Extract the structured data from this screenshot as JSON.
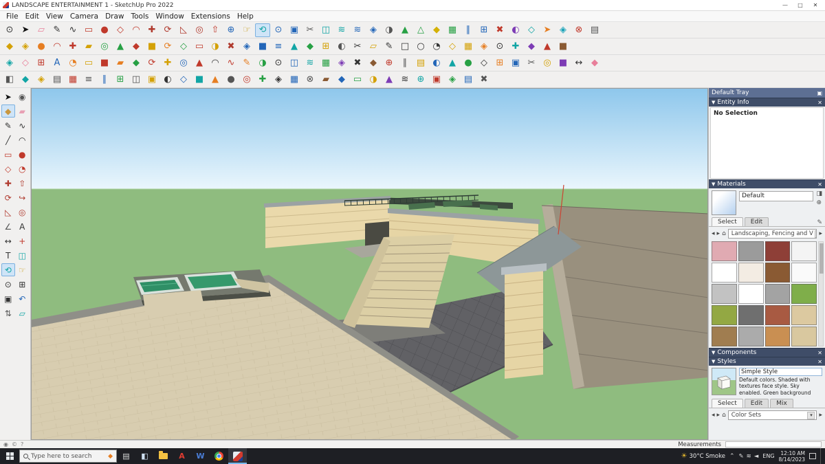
{
  "window": {
    "title": "LANDSCAPE ENTERTAINMENT 1 - SketchUp Pro 2022",
    "controls": {
      "minimize": "—",
      "maximize": "□",
      "close": "✕"
    }
  },
  "menus": [
    "File",
    "Edit",
    "View",
    "Camera",
    "Draw",
    "Tools",
    "Window",
    "Extensions",
    "Help"
  ],
  "tb1": [
    {
      "g": "⊙",
      "c": "#333333",
      "n": "zoom-icon"
    },
    {
      "g": "➤",
      "c": "#111111",
      "n": "select-tool-icon"
    },
    {
      "g": "▱",
      "c": "#e87f9a",
      "n": "eraser-icon"
    },
    {
      "g": "✎",
      "c": "#333333",
      "n": "line-tool-icon"
    },
    {
      "g": "∿",
      "c": "#333333",
      "n": "freehand-icon"
    },
    {
      "g": "▭",
      "c": "#c0392b",
      "n": "rectangle-icon"
    },
    {
      "g": "●",
      "c": "#c0392b",
      "n": "circle-icon"
    },
    {
      "g": "◇",
      "c": "#c0392b",
      "n": "polygon-icon"
    },
    {
      "g": "◠",
      "c": "#c0392b",
      "n": "arc-icon"
    },
    {
      "g": "✚",
      "c": "#b03a2e",
      "n": "move-icon"
    },
    {
      "g": "⟳",
      "c": "#b03a2e",
      "n": "rotate-icon"
    },
    {
      "g": "◺",
      "c": "#b03a2e",
      "n": "scale-icon"
    },
    {
      "g": "◎",
      "c": "#b03a2e",
      "n": "offset-icon"
    },
    {
      "g": "⇧",
      "c": "#c0392b",
      "n": "push-pull-icon"
    },
    {
      "g": "⊕",
      "c": "#2366b8"
    },
    {
      "g": "☞",
      "c": "#c9a227",
      "n": "pan-icon"
    },
    {
      "g": "⟲",
      "c": "#12a5a5",
      "n": "orbit-icon",
      "a": true
    },
    {
      "g": "⊙",
      "c": "#2366b8",
      "n": "zoom-tool-icon"
    },
    {
      "g": "▣",
      "c": "#2366b8",
      "n": "zoom-extents-icon"
    },
    {
      "g": "✂",
      "c": "#555555",
      "n": "section-icon"
    },
    {
      "g": "◫",
      "c": "#12a5a5"
    },
    {
      "g": "≋",
      "c": "#12a5a5"
    },
    {
      "g": "≋",
      "c": "#2366b8"
    },
    {
      "g": "◈",
      "c": "#2366b8"
    },
    {
      "g": "◑",
      "c": "#555555"
    },
    {
      "g": "▲",
      "c": "#27a044"
    },
    {
      "g": "△",
      "c": "#27a044"
    },
    {
      "g": "◆",
      "c": "#d4b106"
    },
    {
      "g": "▦",
      "c": "#27a044"
    },
    {
      "g": "∥",
      "c": "#2366b8"
    },
    {
      "g": "⊞",
      "c": "#2366b8"
    },
    {
      "g": "✖",
      "c": "#c0392b"
    },
    {
      "g": "◐",
      "c": "#7d3cb5"
    },
    {
      "g": "◇",
      "c": "#12a5a5"
    },
    {
      "g": "➤",
      "c": "#e67e22"
    },
    {
      "g": "◈",
      "c": "#17a2b8"
    },
    {
      "g": "⊗",
      "c": "#c0392b"
    },
    {
      "g": "▤",
      "c": "#555555"
    }
  ],
  "tb2": [
    {
      "g": "◆",
      "c": "#d4a106"
    },
    {
      "g": "◈",
      "c": "#d4a106"
    },
    {
      "g": "●",
      "c": "#e67e22"
    },
    {
      "g": "◠",
      "c": "#c0392b"
    },
    {
      "g": "✚",
      "c": "#c0392b"
    },
    {
      "g": "▰",
      "c": "#d4a106"
    },
    {
      "g": "◎",
      "c": "#27a044"
    },
    {
      "g": "▲",
      "c": "#27a044"
    },
    {
      "g": "◆",
      "c": "#c0392b"
    },
    {
      "g": "■",
      "c": "#d4a106"
    },
    {
      "g": "⟳",
      "c": "#e67e22"
    },
    {
      "g": "◇",
      "c": "#27a044"
    },
    {
      "g": "▭",
      "c": "#c0392b"
    },
    {
      "g": "◑",
      "c": "#d4a106"
    },
    {
      "g": "✖",
      "c": "#b03a2e"
    },
    {
      "g": "◈",
      "c": "#2366b8"
    },
    {
      "g": "■",
      "c": "#2366b8"
    },
    {
      "g": "≡",
      "c": "#2366b8"
    },
    {
      "g": "▲",
      "c": "#12a5a5"
    },
    {
      "g": "◆",
      "c": "#27a044"
    },
    {
      "g": "⊞",
      "c": "#d4a106"
    },
    {
      "g": "◐",
      "c": "#555555"
    },
    {
      "g": "✂",
      "c": "#333333"
    },
    {
      "g": "▱",
      "c": "#d4a106"
    },
    {
      "g": "✎",
      "c": "#333333"
    },
    {
      "g": "□",
      "c": "#333333"
    },
    {
      "g": "○",
      "c": "#333333"
    },
    {
      "g": "◔",
      "c": "#333333"
    },
    {
      "g": "◇",
      "c": "#d4a106"
    },
    {
      "g": "▦",
      "c": "#d4a106"
    },
    {
      "g": "◈",
      "c": "#e67e22"
    },
    {
      "g": "⊙",
      "c": "#333333"
    },
    {
      "g": "✚",
      "c": "#12a5a5"
    },
    {
      "g": "◆",
      "c": "#7d3cb5"
    },
    {
      "g": "▲",
      "c": "#c0392b"
    },
    {
      "g": "■",
      "c": "#8a5a33"
    }
  ],
  "tb3": [
    {
      "g": "◈",
      "c": "#12a5a5"
    },
    {
      "g": "◇",
      "c": "#e87f9a"
    },
    {
      "g": "⊞",
      "c": "#c0392b"
    },
    {
      "g": "A",
      "c": "#2366b8",
      "n": "text-style-icon"
    },
    {
      "g": "◔",
      "c": "#e67e22"
    },
    {
      "g": "▭",
      "c": "#d4a106"
    },
    {
      "g": "■",
      "c": "#c0392b"
    },
    {
      "g": "▰",
      "c": "#e67e22"
    },
    {
      "g": "◆",
      "c": "#27a044"
    },
    {
      "g": "⟳",
      "c": "#c0392b"
    },
    {
      "g": "✚",
      "c": "#d4a106"
    },
    {
      "g": "◎",
      "c": "#2366b8"
    },
    {
      "g": "▲",
      "c": "#c0392b"
    },
    {
      "g": "◠",
      "c": "#333333"
    },
    {
      "g": "∿",
      "c": "#c0392b"
    },
    {
      "g": "✎",
      "c": "#e67e22"
    },
    {
      "g": "◑",
      "c": "#27a044"
    },
    {
      "g": "⊙",
      "c": "#333333"
    },
    {
      "g": "◫",
      "c": "#2366b8"
    },
    {
      "g": "≋",
      "c": "#12a5a5"
    },
    {
      "g": "▦",
      "c": "#27a044"
    },
    {
      "g": "◈",
      "c": "#7d3cb5"
    },
    {
      "g": "✖",
      "c": "#333333"
    },
    {
      "g": "◆",
      "c": "#8a5a33"
    },
    {
      "g": "⊕",
      "c": "#c0392b"
    },
    {
      "g": "∥",
      "c": "#555555"
    },
    {
      "g": "▤",
      "c": "#d4a106"
    },
    {
      "g": "◐",
      "c": "#2366b8"
    },
    {
      "g": "▲",
      "c": "#12a5a5"
    },
    {
      "g": "●",
      "c": "#27a044"
    },
    {
      "g": "◇",
      "c": "#333333"
    },
    {
      "g": "⊞",
      "c": "#e67e22"
    },
    {
      "g": "▣",
      "c": "#2366b8"
    },
    {
      "g": "✂",
      "c": "#555555"
    },
    {
      "g": "◎",
      "c": "#d4a106"
    },
    {
      "g": "■",
      "c": "#7d3cb5"
    },
    {
      "g": "↔",
      "c": "#333333"
    },
    {
      "g": "◆",
      "c": "#e87f9a"
    }
  ],
  "tb4": [
    {
      "g": "◧",
      "c": "#555555"
    },
    {
      "g": "◆",
      "c": "#12a5a5"
    },
    {
      "g": "◈",
      "c": "#d4a106"
    },
    {
      "g": "▤",
      "c": "#555555"
    },
    {
      "g": "▦",
      "c": "#c0392b"
    },
    {
      "g": "≡",
      "c": "#555555"
    },
    {
      "g": "∥",
      "c": "#2366b8"
    },
    {
      "g": "⊞",
      "c": "#27a044"
    },
    {
      "g": "◫",
      "c": "#555555"
    },
    {
      "g": "▣",
      "c": "#d4a106"
    },
    {
      "g": "◐",
      "c": "#333333"
    },
    {
      "g": "◇",
      "c": "#2366b8"
    },
    {
      "g": "■",
      "c": "#12a5a5"
    },
    {
      "g": "▲",
      "c": "#e67e22"
    },
    {
      "g": "●",
      "c": "#555555"
    },
    {
      "g": "◎",
      "c": "#c0392b"
    },
    {
      "g": "✚",
      "c": "#27a044"
    },
    {
      "g": "◈",
      "c": "#333333"
    },
    {
      "g": "▦",
      "c": "#2366b8"
    },
    {
      "g": "⊗",
      "c": "#555555"
    },
    {
      "g": "▰",
      "c": "#8a5a33"
    },
    {
      "g": "◆",
      "c": "#2366b8"
    },
    {
      "g": "▭",
      "c": "#27a044"
    },
    {
      "g": "◑",
      "c": "#d4a106"
    },
    {
      "g": "▲",
      "c": "#7d3cb5"
    },
    {
      "g": "≋",
      "c": "#333333"
    },
    {
      "g": "⊕",
      "c": "#12a5a5"
    },
    {
      "g": "▣",
      "c": "#c0392b"
    },
    {
      "g": "◈",
      "c": "#27a044"
    },
    {
      "g": "▤",
      "c": "#2366b8"
    },
    {
      "g": "✖",
      "c": "#555555"
    }
  ],
  "tools": [
    {
      "g": "➤",
      "c": "#111111",
      "n": "select-tool-icon"
    },
    {
      "g": "◉",
      "c": "#555555",
      "n": "look-around-icon"
    },
    {
      "g": "◆",
      "c": "#c9973f",
      "n": "paint-bucket-icon",
      "a": true
    },
    {
      "g": "▰",
      "c": "#e8a0b4",
      "n": "eraser-icon"
    },
    {
      "g": "✎",
      "c": "#333333",
      "n": "pencil-icon"
    },
    {
      "g": "∿",
      "c": "#333333",
      "n": "freehand-icon"
    },
    {
      "g": "╱",
      "c": "#333333",
      "n": "line-icon"
    },
    {
      "g": "◠",
      "c": "#333333",
      "n": "arc-icon"
    },
    {
      "g": "▭",
      "c": "#c0392b",
      "n": "rectangle-icon"
    },
    {
      "g": "●",
      "c": "#c0392b",
      "n": "circle-icon"
    },
    {
      "g": "◇",
      "c": "#c0392b",
      "n": "polygon-icon"
    },
    {
      "g": "◔",
      "c": "#c0392b",
      "n": "pie-icon"
    },
    {
      "g": "✚",
      "c": "#b03a2e",
      "n": "move-icon"
    },
    {
      "g": "⇧",
      "c": "#b03a2e",
      "n": "push-pull-icon"
    },
    {
      "g": "⟳",
      "c": "#b03a2e",
      "n": "rotate-icon"
    },
    {
      "g": "↪",
      "c": "#b03a2e",
      "n": "follow-me-icon"
    },
    {
      "g": "◺",
      "c": "#b03a2e",
      "n": "scale-icon"
    },
    {
      "g": "◎",
      "c": "#b03a2e",
      "n": "offset-icon"
    },
    {
      "g": "∠",
      "c": "#555555",
      "n": "protractor-icon"
    },
    {
      "g": "A",
      "c": "#333333",
      "n": "text-icon"
    },
    {
      "g": "↔",
      "c": "#333333",
      "n": "dimension-icon"
    },
    {
      "g": "+",
      "c": "#c0392b",
      "n": "axes-icon"
    },
    {
      "g": "T",
      "c": "#333333",
      "n": "3d-text-icon"
    },
    {
      "g": "◫",
      "c": "#12a5a5",
      "n": "section-plane-icon"
    },
    {
      "g": "⟲",
      "c": "#12a5a5",
      "n": "orbit-icon",
      "a": true
    },
    {
      "g": "☞",
      "c": "#c9a227",
      "n": "pan-icon"
    },
    {
      "g": "⊙",
      "c": "#333333",
      "n": "zoom-icon"
    },
    {
      "g": "⊞",
      "c": "#333333",
      "n": "zoom-window-icon"
    },
    {
      "g": "▣",
      "c": "#333333",
      "n": "zoom-extents-icon"
    },
    {
      "g": "↶",
      "c": "#2366b8",
      "n": "previous-view-icon"
    },
    {
      "g": "⇅",
      "c": "#555555",
      "n": "walk-icon"
    },
    {
      "g": "▱",
      "c": "#12a5a5",
      "n": "section-fill-icon"
    }
  ],
  "tray": {
    "title": "Default Tray",
    "entity_info": {
      "title": "Entity Info",
      "status": "No Selection"
    },
    "materials": {
      "title": "Materials",
      "current": "Default",
      "tabs": [
        "Select",
        "Edit"
      ],
      "dropdown": "Landscaping, Fencing and V"
    },
    "components": {
      "title": "Components"
    },
    "styles": {
      "title": "Styles",
      "name": "Simple Style",
      "desc": "Default colors.  Shaded with textures face style.  Sky enabled.  Green background",
      "tabs": [
        "Select",
        "Edit",
        "Mix"
      ],
      "dropdown": "Color Sets"
    }
  },
  "swatches": [
    {
      "bg": "#e0aab2",
      "fg": "#c17484",
      "p": "checker"
    },
    {
      "bg": "#9b9b9b",
      "fg": "#7f7f7f",
      "p": "grid"
    },
    {
      "bg": "#8e3f37",
      "fg": "#7a342d",
      "p": "grid"
    },
    {
      "bg": "#f4f4f4",
      "fg": "#dcdcdc",
      "p": "grid"
    },
    {
      "bg": "#ffffff",
      "fg": "#444444",
      "p": "diamond"
    },
    {
      "bg": "#f3ece3",
      "fg": "#c0392b",
      "p": "diamond"
    },
    {
      "bg": "#8a5a33",
      "fg": "#6d4523",
      "p": "cross"
    },
    {
      "bg": "#fafafa",
      "fg": "#cccccc",
      "p": "vlines"
    },
    {
      "bg": "#c2c2c2",
      "fg": "#9e9e9e",
      "p": "grid"
    },
    {
      "bg": "#ffffff",
      "fg": "#bbbbbb",
      "p": "vlines"
    },
    {
      "bg": "#a3a3a3",
      "fg": "#8b8b8b",
      "p": "dots"
    },
    {
      "bg": "#7fae4a",
      "fg": "#6d9a3d",
      "p": "dots"
    },
    {
      "bg": "#93a843",
      "fg": "#7e9136",
      "p": "dots"
    },
    {
      "bg": "#6f6f6f",
      "fg": "#5c5c5c",
      "p": "dots"
    },
    {
      "bg": "#a85a42",
      "fg": "#8d4531",
      "p": "dots"
    },
    {
      "bg": "#dcc9a0",
      "fg": "#c4b086",
      "p": "plain"
    },
    {
      "bg": "#a07d50",
      "fg": "#86653c",
      "p": "dots"
    },
    {
      "bg": "#ababab",
      "fg": "#8f8f8f",
      "p": "dots"
    },
    {
      "bg": "#c98f52",
      "fg": "#ad7439",
      "p": "dots"
    },
    {
      "bg": "#d9c89f",
      "fg": "#c0ae83",
      "p": "grid"
    }
  ],
  "statusbar": {
    "measurements": "Measurements"
  },
  "taskbar": {
    "search_placeholder": "Type here to search",
    "weather": "30°C Smoke",
    "lang": "ENG",
    "time": "12:10 AM",
    "date": "8/14/2023"
  },
  "apps": [
    {
      "n": "task-view-icon",
      "t": "glyph",
      "g": "▤",
      "c": "#d8d8d8"
    },
    {
      "n": "widgets-icon",
      "t": "glyph",
      "g": "◧",
      "c": "#cfe0f2"
    },
    {
      "n": "file-explorer-icon",
      "t": "folder"
    },
    {
      "n": "acrobat-icon",
      "t": "letter",
      "g": "A",
      "c": "#e03c31"
    },
    {
      "n": "word-icon",
      "t": "letter",
      "g": "W",
      "c": "#4a7dd6"
    },
    {
      "n": "chrome-icon",
      "t": "chrome"
    },
    {
      "n": "sketchup-icon",
      "t": "sketchup",
      "active": true
    }
  ],
  "tray_icons": [
    {
      "n": "pen-icon",
      "g": "✎"
    },
    {
      "n": "network-icon",
      "g": "≋"
    },
    {
      "n": "volume-icon",
      "g": "◄"
    }
  ],
  "viewport_colors": {
    "sky_top": "#8ec7ec",
    "sky_bottom": "#eaf6fc",
    "ground": "#8fbc7f"
  }
}
